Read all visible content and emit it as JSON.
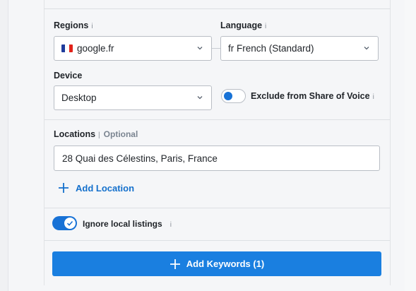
{
  "regions": {
    "label": "Regions",
    "info": "i",
    "selected": "google.fr",
    "flag_colors": [
      "#1f3c9c",
      "#ffffff",
      "#e2231a"
    ]
  },
  "language": {
    "label": "Language",
    "info": "i",
    "selected": "fr French (Standard)"
  },
  "device": {
    "label": "Device",
    "selected": "Desktop"
  },
  "share_of_voice": {
    "label": "Exclude from Share of Voice",
    "info": "i",
    "enabled": false
  },
  "locations": {
    "label": "Locations",
    "optional": "Optional",
    "separator": "|",
    "value": "28 Quai des Célestins, Paris, France",
    "add_label": "Add Location"
  },
  "local_listings": {
    "label": "Ignore local listings",
    "info": "i",
    "enabled": true
  },
  "submit": {
    "label": "Add Keywords (1)"
  },
  "colors": {
    "accent": "#1a7fe0",
    "link": "#1470cc"
  }
}
